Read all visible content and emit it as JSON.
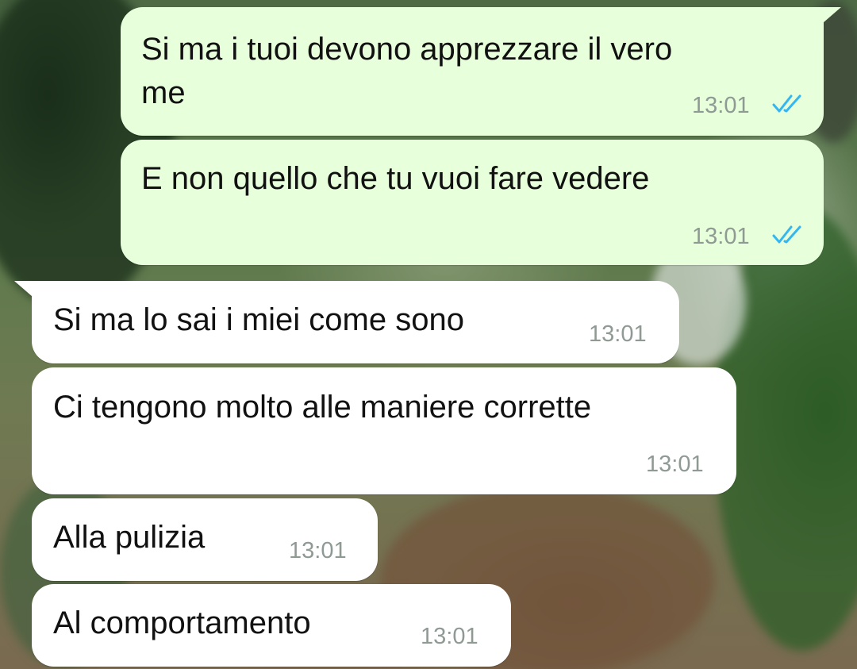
{
  "theme": {
    "outgoing_bubble": "#e7ffdb",
    "incoming_bubble": "#ffffff",
    "text_color": "#111111",
    "time_color": "#8f9a94",
    "read_tick_color": "#34b7f1"
  },
  "messages": [
    {
      "direction": "outgoing",
      "text_line1": "Si ma i tuoi devono apprezzare il vero",
      "text_line2": "me",
      "time": "13:01",
      "status_icon": "double-check-read-icon"
    },
    {
      "direction": "outgoing",
      "text": "E non quello che tu vuoi fare vedere",
      "time": "13:01",
      "status_icon": "double-check-read-icon"
    },
    {
      "direction": "incoming",
      "text": "Si ma lo sai i miei come sono",
      "time": "13:01"
    },
    {
      "direction": "incoming",
      "text": "Ci tengono molto alle maniere corrette",
      "time": "13:01"
    },
    {
      "direction": "incoming",
      "text": "Alla pulizia",
      "time": "13:01"
    },
    {
      "direction": "incoming",
      "text": "Al comportamento",
      "time": "13:01"
    }
  ]
}
